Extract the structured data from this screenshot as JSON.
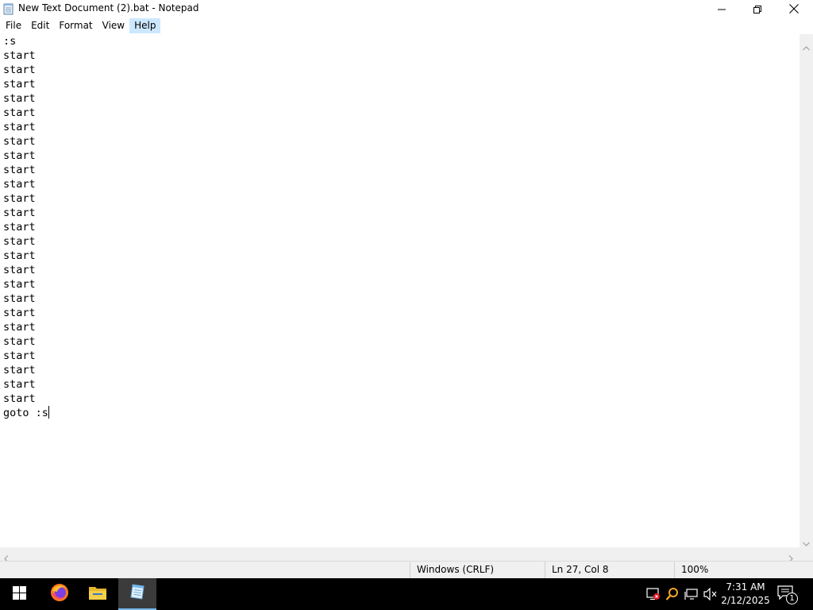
{
  "window": {
    "title": "New Text Document (2).bat - Notepad",
    "app_icon": "notepad-icon",
    "controls": [
      "minimize-icon",
      "restore-icon",
      "close-icon"
    ]
  },
  "menu": {
    "items": [
      {
        "label": "File"
      },
      {
        "label": "Edit"
      },
      {
        "label": "Format"
      },
      {
        "label": "View"
      },
      {
        "label": "Help",
        "active": true
      }
    ]
  },
  "editor": {
    "content": ":s\nstart\nstart\nstart\nstart\nstart\nstart\nstart\nstart\nstart\nstart\nstart\nstart\nstart\nstart\nstart\nstart\nstart\nstart\nstart\nstart\nstart\nstart\nstart\nstart\nstart\ngoto :s"
  },
  "status": {
    "line_ending": "Windows (CRLF)",
    "position": "Ln 27, Col 8",
    "zoom": "100%"
  },
  "taskbar": {
    "items": [
      "windows-start-icon",
      "firefox-icon",
      "file-explorer-icon",
      "notepad-icon"
    ],
    "active_item": "notepad-icon",
    "tray": [
      "security-warning-icon",
      "search-icon",
      "network-icon",
      "volume-muted-icon"
    ],
    "time": "7:31 AM",
    "date": "2/12/2025",
    "notification_count": "1"
  },
  "colors": {
    "menu_highlight": "#cce8ff",
    "taskbar_bg": "#000000",
    "active_task_underline": "#76b9ed"
  }
}
